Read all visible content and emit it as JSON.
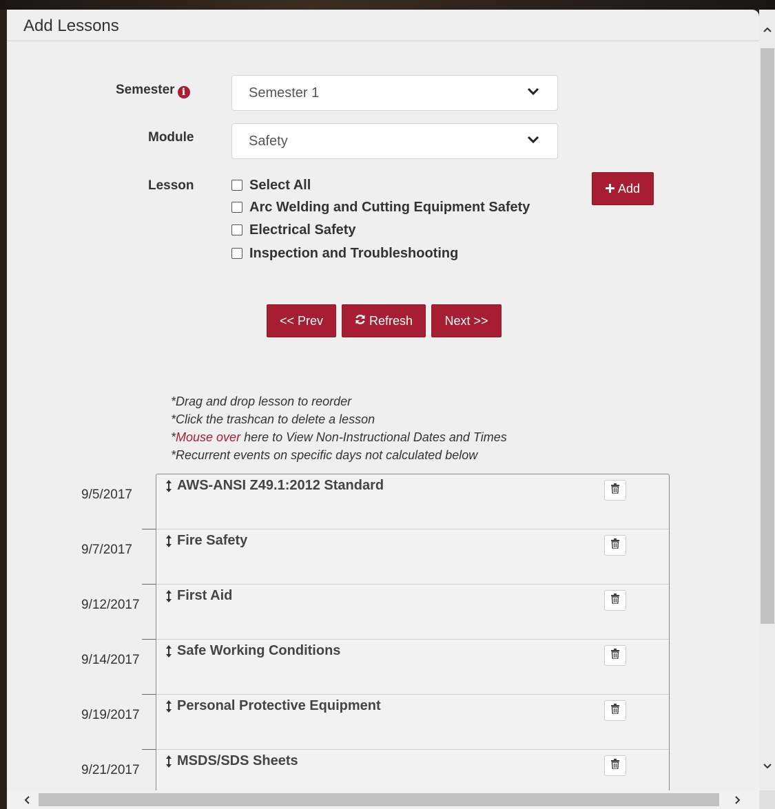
{
  "panel": {
    "title": "Add Lessons"
  },
  "form": {
    "semester": {
      "label": "Semester",
      "value": "Semester 1"
    },
    "module": {
      "label": "Module",
      "value": "Safety"
    },
    "lesson": {
      "label": "Lesson",
      "options": [
        {
          "label": "Select All",
          "checked": false
        },
        {
          "label": "Arc Welding and Cutting Equipment Safety",
          "checked": false
        },
        {
          "label": "Electrical Safety",
          "checked": false
        },
        {
          "label": "Inspection and Troubleshooting",
          "checked": false
        }
      ]
    },
    "add_label": "Add"
  },
  "nav": {
    "prev_label": "<< Prev",
    "refresh_label": "Refresh",
    "next_label": "Next >>"
  },
  "notes": {
    "line1": "*Drag and drop lesson to reorder",
    "line2": "*Click the trashcan to delete a lesson",
    "line3_prefix": "*",
    "line3_link": "Mouse over",
    "line3_suffix": " here to View Non-Instructional Dates and Times",
    "line4": "*Recurrent events on specific days not calculated below"
  },
  "schedule": [
    {
      "date": "9/5/2017",
      "lesson": "AWS-ANSI Z49.1:2012 Standard"
    },
    {
      "date": "9/7/2017",
      "lesson": "Fire Safety"
    },
    {
      "date": "9/12/2017",
      "lesson": "First Aid"
    },
    {
      "date": "9/14/2017",
      "lesson": "Safe Working Conditions"
    },
    {
      "date": "9/19/2017",
      "lesson": "Personal Protective Equipment"
    },
    {
      "date": "9/21/2017",
      "lesson": "MSDS/SDS Sheets"
    }
  ],
  "colors": {
    "accent": "#a71d31",
    "panel_bg": "#efefef"
  },
  "icons": {
    "info": "info-icon",
    "dropdown": "chevron-down-icon",
    "add": "plus-icon",
    "refresh": "refresh-icon",
    "drag": "drag-handle-icon",
    "delete": "trash-icon"
  }
}
